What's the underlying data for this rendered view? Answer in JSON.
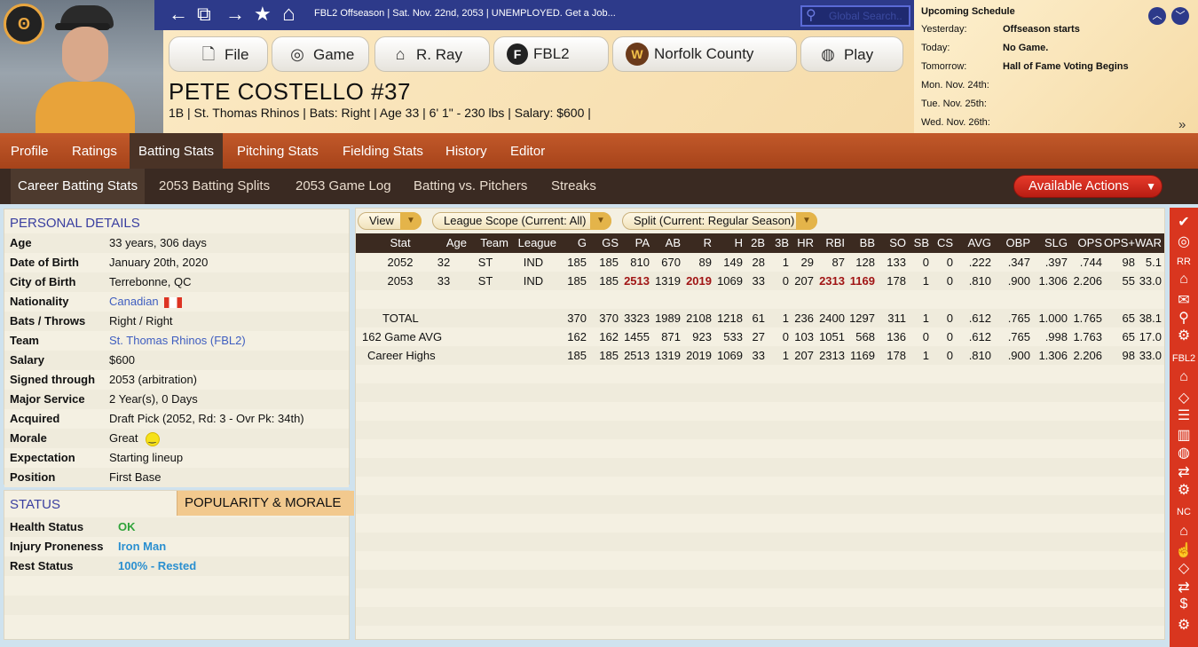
{
  "header": {
    "nav": {
      "back": "←",
      "copy": "⧉",
      "forward": "→",
      "star": "★",
      "home": "⌂"
    },
    "breadcrumb": "FBL2 Offseason  |  Sat. Nov. 22nd, 2053  |  UNEMPLOYED. Get a Job...",
    "search_placeholder": "Global Search..",
    "menu": [
      {
        "label": "File",
        "icon": "file-icon",
        "glyph": "🗋"
      },
      {
        "label": "Game",
        "icon": "globe-icon",
        "glyph": "🌐"
      },
      {
        "label": "R. Ray",
        "icon": "home-icon",
        "glyph": "⌂"
      },
      {
        "label": "FBL2",
        "icon": "fbl2-logo-icon",
        "glyph": "F"
      },
      {
        "label": "Norfolk County",
        "icon": "team-logo-icon",
        "glyph": "W"
      },
      {
        "label": "Play",
        "icon": "baseball-icon",
        "glyph": "◍"
      }
    ]
  },
  "player": {
    "name": "PETE COSTELLO   #37",
    "info": "1B | St. Thomas Rhinos  |  Bats: Right  |  Age 33  |  6' 1\" - 230 lbs  |  Salary: $600  |"
  },
  "schedule": {
    "title": "Upcoming Schedule",
    "rows": [
      {
        "k": "Yesterday:",
        "v": "Offseason starts"
      },
      {
        "k": "Today:",
        "v": "No Game."
      },
      {
        "k": "Tomorrow:",
        "v": "Hall of Fame Voting Begins"
      },
      {
        "k": "Mon. Nov. 24th:",
        "v": ""
      },
      {
        "k": "Tue. Nov. 25th:",
        "v": ""
      },
      {
        "k": "Wed. Nov. 26th:",
        "v": ""
      }
    ],
    "more": "»"
  },
  "tabs1": [
    "Profile",
    "Ratings",
    "Batting Stats",
    "Pitching Stats",
    "Fielding Stats",
    "History",
    "Editor"
  ],
  "tabs2": [
    "Career Batting Stats",
    "2053 Batting Splits",
    "2053 Game Log",
    "Batting vs. Pitchers",
    "Streaks"
  ],
  "actions_label": "Available Actions",
  "personal": {
    "title": "PERSONAL DETAILS",
    "rows": [
      {
        "k": "Age",
        "v": "33 years, 306 days"
      },
      {
        "k": "Date of Birth",
        "v": "January 20th, 2020"
      },
      {
        "k": "City of Birth",
        "v": "Terrebonne, QC"
      },
      {
        "k": "Nationality",
        "v": "Canadian"
      },
      {
        "k": "Bats / Throws",
        "v": "Right / Right"
      },
      {
        "k": "Team",
        "v": "St. Thomas Rhinos (FBL2)"
      },
      {
        "k": "Salary",
        "v": "$600"
      },
      {
        "k": "Signed through",
        "v": "2053 (arbitration)"
      },
      {
        "k": "Major Service",
        "v": "2 Year(s), 0 Days"
      },
      {
        "k": "Acquired",
        "v": "Draft Pick (2052, Rd: 3 - Ovr Pk: 34th)"
      },
      {
        "k": "Morale",
        "v": "Great"
      },
      {
        "k": "Expectation",
        "v": "Starting lineup"
      },
      {
        "k": "Position",
        "v": "First Base"
      }
    ]
  },
  "status": {
    "title": "STATUS",
    "tab2": "POPULARITY & MORALE",
    "rows": [
      {
        "k": "Health Status",
        "v": "OK",
        "color": "#2fa33a"
      },
      {
        "k": "Injury Proneness",
        "v": "Iron Man",
        "color": "#2a8fd0"
      },
      {
        "k": "Rest Status",
        "v": "100% - Rested",
        "color": "#2a8fd0"
      }
    ]
  },
  "filters": [
    "View",
    "League Scope  (Current: All)",
    "Split  (Current: Regular Season)"
  ],
  "stats": {
    "columns": [
      "Stat",
      "Age",
      "Team",
      "League",
      "G",
      "GS",
      "PA",
      "AB",
      "R",
      "H",
      "2B",
      "3B",
      "HR",
      "RBI",
      "BB",
      "SO",
      "SB",
      "CS",
      "AVG",
      "OBP",
      "SLG",
      "OPS",
      "OPS+",
      "WAR"
    ],
    "rows": [
      [
        "2052",
        "32",
        "ST",
        "IND",
        "185",
        "185",
        "810",
        "670",
        "89",
        "149",
        "28",
        "1",
        "29",
        "87",
        "128",
        "133",
        "0",
        "0",
        ".222",
        ".347",
        ".397",
        ".744",
        "98",
        "5.1"
      ],
      [
        "2053",
        "33",
        "ST",
        "IND",
        "185",
        "185",
        "2513",
        "1319",
        "2019",
        "1069",
        "33",
        "0",
        "207",
        "2313",
        "1169",
        "178",
        "1",
        "0",
        ".810",
        ".900",
        "1.306",
        "2.206",
        "55",
        "33.0"
      ],
      [
        "",
        "",
        "",
        "",
        "",
        "",
        "",
        "",
        "",
        "",
        "",
        "",
        "",
        "",
        "",
        "",
        "",
        "",
        "",
        "",
        "",
        "",
        "",
        ""
      ],
      [
        "TOTAL",
        "",
        "",
        "",
        "370",
        "370",
        "3323",
        "1989",
        "2108",
        "1218",
        "61",
        "1",
        "236",
        "2400",
        "1297",
        "311",
        "1",
        "0",
        ".612",
        ".765",
        "1.000",
        "1.765",
        "65",
        "38.1"
      ],
      [
        "162 Game AVG",
        "",
        "",
        "",
        "162",
        "162",
        "1455",
        "871",
        "923",
        "533",
        "27",
        "0",
        "103",
        "1051",
        "568",
        "136",
        "0",
        "0",
        ".612",
        ".765",
        ".998",
        "1.763",
        "65",
        "17.0"
      ],
      [
        "Career Highs",
        "",
        "",
        "",
        "185",
        "185",
        "2513",
        "1319",
        "2019",
        "1069",
        "33",
        "1",
        "207",
        "2313",
        "1169",
        "178",
        "1",
        "0",
        ".810",
        ".900",
        "1.306",
        "2.206",
        "98",
        "33.0"
      ]
    ],
    "highlight": [
      [
        1,
        6
      ],
      [
        1,
        8
      ],
      [
        1,
        13
      ],
      [
        1,
        14
      ]
    ]
  },
  "sidebar": {
    "labels": [
      "RR",
      "FBL2",
      "NC"
    ]
  }
}
